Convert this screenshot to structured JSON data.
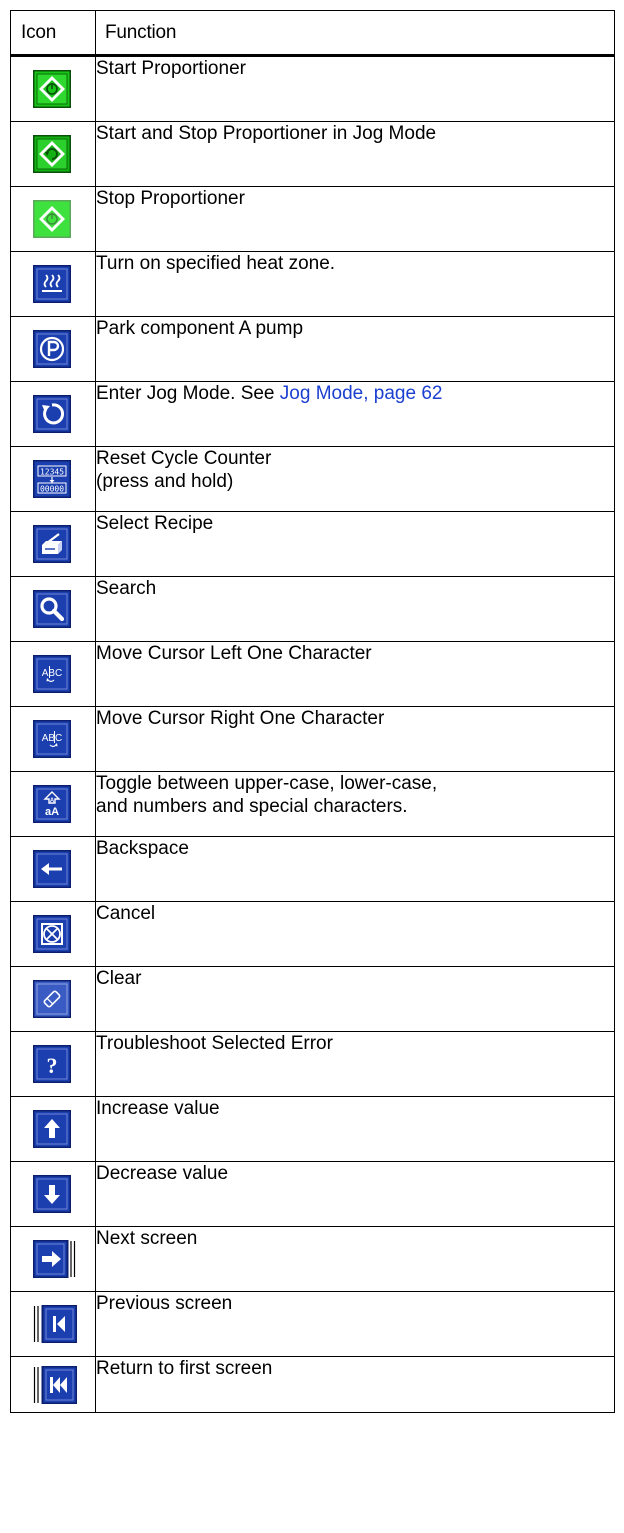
{
  "table": {
    "header": {
      "icon": "Icon",
      "function": "Function"
    },
    "rows": [
      {
        "icon": "start-proportioner-icon",
        "function": "Start Proportioner"
      },
      {
        "icon": "jog-start-stop-icon",
        "function": "Start and Stop Proportioner in Jog Mode"
      },
      {
        "icon": "stop-proportioner-icon",
        "function": "Stop Proportioner"
      },
      {
        "icon": "heat-zone-icon",
        "function": "Turn on specified heat zone."
      },
      {
        "icon": "park-pump-icon",
        "function": "Park component A pump"
      },
      {
        "icon": "jog-mode-icon",
        "function_prefix": "Enter Jog Mode. See ",
        "link_text": "Jog Mode, page 62"
      },
      {
        "icon": "reset-counter-icon",
        "function": "Reset Cycle Counter\n(press and hold)"
      },
      {
        "icon": "select-recipe-icon",
        "function": "Select Recipe"
      },
      {
        "icon": "search-icon",
        "function": "Search"
      },
      {
        "icon": "cursor-left-icon",
        "function": "Move Cursor Left One Character"
      },
      {
        "icon": "cursor-right-icon",
        "function": "Move Cursor Right One Character"
      },
      {
        "icon": "case-toggle-icon",
        "function": "Toggle between upper-case, lower-case,\nand numbers and special characters."
      },
      {
        "icon": "backspace-icon",
        "function": "Backspace"
      },
      {
        "icon": "cancel-icon",
        "function": "Cancel"
      },
      {
        "icon": "clear-icon",
        "function": "Clear"
      },
      {
        "icon": "troubleshoot-icon",
        "function": "Troubleshoot Selected Error"
      },
      {
        "icon": "increase-icon",
        "function": "Increase value"
      },
      {
        "icon": "decrease-icon",
        "function": "Decrease value"
      },
      {
        "icon": "next-screen-icon",
        "function": "Next screen"
      },
      {
        "icon": "previous-screen-icon",
        "function": "Previous screen"
      },
      {
        "icon": "first-screen-icon",
        "function": "Return to first screen"
      }
    ],
    "icon_text": {
      "counter_top": "12345",
      "counter_bottom": "00000",
      "abc": "ABC",
      "case_upper": "A",
      "case_lower": "aA",
      "question": "?"
    }
  },
  "colors": {
    "icon_blue": "#1b3fae",
    "icon_blue_border": "#0b1f6e",
    "start_green": "#19c419",
    "stop_green": "#3fe13f",
    "link_blue": "#1a3fd1"
  }
}
